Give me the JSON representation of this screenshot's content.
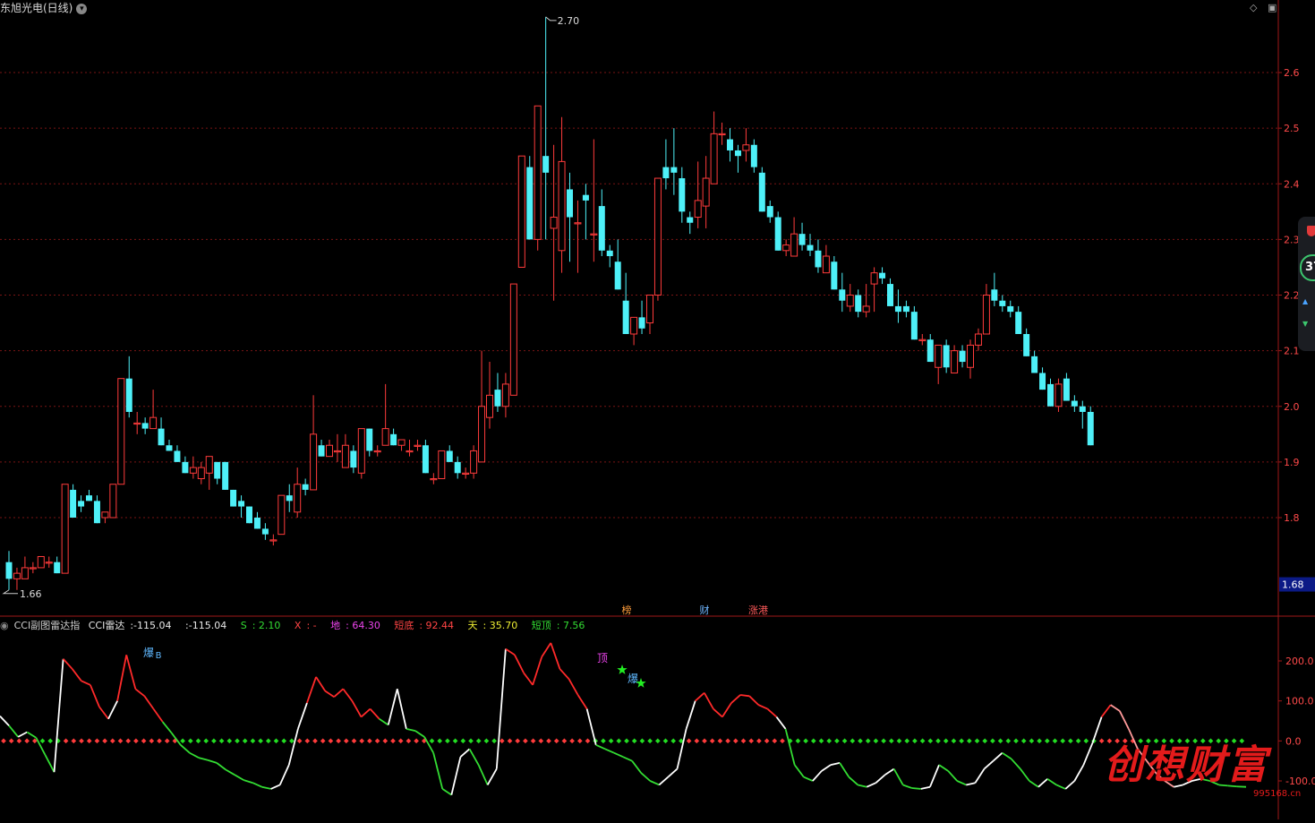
{
  "title": "东旭光电(日线)",
  "price_axis": {
    "ticks": [
      "2.6",
      "2.5",
      "2.4",
      "2.3",
      "2.2",
      "2.1",
      "2.0",
      "1.9",
      "1.8"
    ],
    "tick_values": [
      2.6,
      2.5,
      2.4,
      2.3,
      2.2,
      2.1,
      2.0,
      1.9,
      1.8
    ],
    "current_price_label": "1.68",
    "current_price": 1.68
  },
  "chart_data": [
    {
      "type": "candlestick",
      "ylim": [
        1.62,
        2.75
      ],
      "up_color": "#ff3b3b",
      "down_color": "#4ef0f8",
      "annotations": {
        "high_label": "2.70",
        "low_label": "1.66"
      },
      "event_labels": [
        "榜",
        "财",
        "涨港"
      ],
      "candles": [
        [
          1.72,
          1.74,
          1.67,
          1.69
        ],
        [
          1.69,
          1.71,
          1.67,
          1.7
        ],
        [
          1.69,
          1.73,
          1.69,
          1.71
        ],
        [
          1.71,
          1.72,
          1.7,
          1.71
        ],
        [
          1.71,
          1.73,
          1.71,
          1.73
        ],
        [
          1.72,
          1.73,
          1.71,
          1.72
        ],
        [
          1.72,
          1.73,
          1.7,
          1.7
        ],
        [
          1.7,
          1.86,
          1.7,
          1.86
        ],
        [
          1.85,
          1.86,
          1.8,
          1.8
        ],
        [
          1.83,
          1.84,
          1.81,
          1.82
        ],
        [
          1.84,
          1.85,
          1.83,
          1.83
        ],
        [
          1.83,
          1.84,
          1.79,
          1.79
        ],
        [
          1.8,
          1.81,
          1.79,
          1.81
        ],
        [
          1.8,
          1.86,
          1.8,
          1.86
        ],
        [
          1.86,
          2.05,
          1.86,
          2.05
        ],
        [
          2.05,
          2.09,
          1.98,
          1.99
        ],
        [
          1.97,
          1.99,
          1.95,
          1.97
        ],
        [
          1.97,
          1.98,
          1.95,
          1.96
        ],
        [
          1.96,
          2.03,
          1.96,
          1.98
        ],
        [
          1.96,
          1.98,
          1.93,
          1.93
        ],
        [
          1.93,
          1.94,
          1.92,
          1.92
        ],
        [
          1.92,
          1.93,
          1.9,
          1.9
        ],
        [
          1.9,
          1.91,
          1.88,
          1.88
        ],
        [
          1.88,
          1.91,
          1.87,
          1.89
        ],
        [
          1.87,
          1.9,
          1.86,
          1.89
        ],
        [
          1.88,
          1.91,
          1.85,
          1.91
        ],
        [
          1.9,
          1.9,
          1.86,
          1.87
        ],
        [
          1.9,
          1.9,
          1.85,
          1.85
        ],
        [
          1.85,
          1.85,
          1.82,
          1.82
        ],
        [
          1.83,
          1.84,
          1.8,
          1.82
        ],
        [
          1.82,
          1.82,
          1.79,
          1.79
        ],
        [
          1.8,
          1.81,
          1.78,
          1.78
        ],
        [
          1.78,
          1.79,
          1.76,
          1.77
        ],
        [
          1.76,
          1.77,
          1.75,
          1.76
        ],
        [
          1.77,
          1.84,
          1.77,
          1.84
        ],
        [
          1.84,
          1.86,
          1.81,
          1.83
        ],
        [
          1.81,
          1.89,
          1.8,
          1.86
        ],
        [
          1.86,
          1.87,
          1.84,
          1.85
        ],
        [
          1.85,
          2.02,
          1.85,
          1.95
        ],
        [
          1.93,
          1.94,
          1.91,
          1.91
        ],
        [
          1.91,
          1.94,
          1.91,
          1.93
        ],
        [
          1.92,
          1.95,
          1.9,
          1.92
        ],
        [
          1.89,
          1.95,
          1.89,
          1.93
        ],
        [
          1.92,
          1.93,
          1.88,
          1.89
        ],
        [
          1.88,
          1.95,
          1.87,
          1.96
        ],
        [
          1.96,
          1.96,
          1.91,
          1.92
        ],
        [
          1.92,
          1.93,
          1.91,
          1.92
        ],
        [
          1.93,
          2.04,
          1.93,
          1.96
        ],
        [
          1.95,
          1.96,
          1.93,
          1.93
        ],
        [
          1.93,
          1.94,
          1.92,
          1.94
        ],
        [
          1.92,
          1.94,
          1.91,
          1.92
        ],
        [
          1.93,
          1.94,
          1.92,
          1.93
        ],
        [
          1.93,
          1.94,
          1.88,
          1.88
        ],
        [
          1.87,
          1.88,
          1.86,
          1.87
        ],
        [
          1.87,
          1.92,
          1.87,
          1.92
        ],
        [
          1.92,
          1.93,
          1.9,
          1.9
        ],
        [
          1.9,
          1.91,
          1.87,
          1.88
        ],
        [
          1.88,
          1.89,
          1.87,
          1.88
        ],
        [
          1.88,
          1.93,
          1.87,
          1.92
        ],
        [
          1.9,
          2.1,
          1.9,
          2.0
        ],
        [
          1.98,
          2.08,
          1.96,
          2.02
        ],
        [
          2.03,
          2.06,
          1.99,
          2.0
        ],
        [
          2.0,
          2.06,
          1.98,
          2.04
        ],
        [
          2.02,
          2.22,
          2.02,
          2.22
        ],
        [
          2.25,
          2.42,
          2.25,
          2.45
        ],
        [
          2.43,
          2.45,
          2.3,
          2.3
        ],
        [
          2.3,
          2.54,
          2.28,
          2.54
        ],
        [
          2.45,
          2.7,
          2.3,
          2.42
        ],
        [
          2.32,
          2.47,
          2.19,
          2.34
        ],
        [
          2.28,
          2.52,
          2.24,
          2.44
        ],
        [
          2.39,
          2.42,
          2.26,
          2.34
        ],
        [
          2.33,
          2.37,
          2.24,
          2.33
        ],
        [
          2.38,
          2.4,
          2.3,
          2.37
        ],
        [
          2.31,
          2.48,
          2.26,
          2.31
        ],
        [
          2.36,
          2.39,
          2.27,
          2.28
        ],
        [
          2.28,
          2.29,
          2.25,
          2.27
        ],
        [
          2.26,
          2.3,
          2.21,
          2.21
        ],
        [
          2.19,
          2.24,
          2.13,
          2.13
        ],
        [
          2.13,
          2.16,
          2.11,
          2.16
        ],
        [
          2.16,
          2.19,
          2.13,
          2.14
        ],
        [
          2.15,
          2.2,
          2.13,
          2.2
        ],
        [
          2.2,
          2.41,
          2.19,
          2.41
        ],
        [
          2.43,
          2.48,
          2.39,
          2.41
        ],
        [
          2.43,
          2.5,
          2.38,
          2.42
        ],
        [
          2.41,
          2.43,
          2.33,
          2.35
        ],
        [
          2.34,
          2.35,
          2.31,
          2.33
        ],
        [
          2.34,
          2.44,
          2.32,
          2.37
        ],
        [
          2.36,
          2.45,
          2.32,
          2.41
        ],
        [
          2.4,
          2.53,
          2.4,
          2.49
        ],
        [
          2.49,
          2.51,
          2.47,
          2.49
        ],
        [
          2.48,
          2.5,
          2.44,
          2.46
        ],
        [
          2.46,
          2.47,
          2.42,
          2.45
        ],
        [
          2.46,
          2.5,
          2.44,
          2.47
        ],
        [
          2.47,
          2.48,
          2.42,
          2.43
        ],
        [
          2.42,
          2.43,
          2.35,
          2.35
        ],
        [
          2.36,
          2.37,
          2.33,
          2.34
        ],
        [
          2.34,
          2.35,
          2.28,
          2.28
        ],
        [
          2.28,
          2.3,
          2.27,
          2.29
        ],
        [
          2.27,
          2.34,
          2.27,
          2.31
        ],
        [
          2.31,
          2.33,
          2.28,
          2.29
        ],
        [
          2.29,
          2.31,
          2.27,
          2.28
        ],
        [
          2.28,
          2.3,
          2.24,
          2.25
        ],
        [
          2.24,
          2.29,
          2.24,
          2.27
        ],
        [
          2.26,
          2.27,
          2.21,
          2.21
        ],
        [
          2.21,
          2.24,
          2.17,
          2.19
        ],
        [
          2.18,
          2.22,
          2.17,
          2.2
        ],
        [
          2.2,
          2.21,
          2.16,
          2.17
        ],
        [
          2.17,
          2.22,
          2.16,
          2.18
        ],
        [
          2.22,
          2.25,
          2.17,
          2.24
        ],
        [
          2.24,
          2.25,
          2.22,
          2.23
        ],
        [
          2.22,
          2.23,
          2.18,
          2.18
        ],
        [
          2.18,
          2.21,
          2.15,
          2.17
        ],
        [
          2.18,
          2.19,
          2.16,
          2.17
        ],
        [
          2.17,
          2.18,
          2.12,
          2.12
        ],
        [
          2.12,
          2.13,
          2.11,
          2.12
        ],
        [
          2.12,
          2.13,
          2.08,
          2.08
        ],
        [
          2.07,
          2.11,
          2.04,
          2.11
        ],
        [
          2.11,
          2.12,
          2.06,
          2.07
        ],
        [
          2.06,
          2.11,
          2.06,
          2.1
        ],
        [
          2.1,
          2.11,
          2.07,
          2.08
        ],
        [
          2.07,
          2.12,
          2.05,
          2.11
        ],
        [
          2.11,
          2.14,
          2.1,
          2.13
        ],
        [
          2.13,
          2.22,
          2.13,
          2.2
        ],
        [
          2.21,
          2.24,
          2.18,
          2.19
        ],
        [
          2.19,
          2.2,
          2.17,
          2.18
        ],
        [
          2.18,
          2.19,
          2.16,
          2.17
        ],
        [
          2.17,
          2.18,
          2.13,
          2.13
        ],
        [
          2.13,
          2.14,
          2.09,
          2.09
        ],
        [
          2.09,
          2.1,
          2.06,
          2.06
        ],
        [
          2.06,
          2.07,
          2.03,
          2.03
        ],
        [
          2.04,
          2.05,
          2.0,
          2.0
        ],
        [
          2.0,
          2.05,
          1.99,
          2.04
        ],
        [
          2.05,
          2.06,
          2.01,
          2.01
        ],
        [
          2.01,
          2.02,
          1.99,
          2.0
        ],
        [
          2.0,
          2.01,
          1.96,
          1.99
        ],
        [
          1.99,
          2.0,
          1.93,
          1.93
        ]
      ]
    },
    {
      "type": "line",
      "title": "CCI副图雷达指",
      "ylim": [
        -140,
        270
      ],
      "y_ticks": [
        "200.0",
        "100.0",
        "0.0",
        "-100.0"
      ],
      "y_tick_values": [
        200,
        100,
        0,
        -100
      ],
      "legend": {
        "main": {
          "name": "CCI雷达",
          "value": "-115.04"
        },
        "second": {
          "value": "-115.04"
        },
        "s": {
          "name": "S",
          "value": "2.10"
        },
        "x": {
          "name": "X",
          "value": "-"
        },
        "di": {
          "name": "地",
          "value": "64.30"
        },
        "duandi": {
          "name": "短底",
          "value": "92.44"
        },
        "tian": {
          "name": "天",
          "value": "35.70"
        },
        "duanding": {
          "name": "短顶",
          "value": "7.56"
        }
      },
      "marker_labels": {
        "bao": "爆",
        "b": "B",
        "ding": "顶"
      },
      "zero_line_colors": {
        "above": "#ff3b3b",
        "below": "#22dd22"
      },
      "line_colors": {
        "white": "#ffffff",
        "red": "#ff2a2a",
        "green": "#33dd33",
        "pink": "#ff9a9a"
      },
      "values": [
        62,
        38,
        10,
        22,
        8,
        -35,
        -78,
        205,
        180,
        150,
        140,
        85,
        55,
        100,
        215,
        130,
        112,
        80,
        48,
        20,
        -10,
        -30,
        -42,
        -48,
        -55,
        -72,
        -85,
        -98,
        -105,
        -115,
        -120,
        -110,
        -60,
        30,
        95,
        160,
        125,
        110,
        130,
        100,
        60,
        80,
        55,
        40,
        130,
        30,
        25,
        10,
        -30,
        -120,
        -135,
        -40,
        -20,
        -60,
        -110,
        -70,
        230,
        215,
        170,
        140,
        210,
        245,
        180,
        155,
        115,
        80,
        -10,
        -20,
        -30,
        -40,
        -50,
        -80,
        -100,
        -110,
        -90,
        -70,
        30,
        100,
        120,
        80,
        60,
        95,
        115,
        112,
        90,
        80,
        60,
        30,
        -60,
        -90,
        -100,
        -75,
        -60,
        -55,
        -90,
        -110,
        -115,
        -105,
        -85,
        -70,
        -110,
        -118,
        -120,
        -115,
        -60,
        -75,
        -100,
        -110,
        -105,
        -70,
        -50,
        -30,
        -45,
        -70,
        -100,
        -115,
        -95,
        -110,
        -120,
        -100,
        -60,
        -5,
        60,
        90,
        75,
        30,
        -20,
        -50,
        -80,
        -100,
        -115,
        -110,
        -100,
        -95,
        -100,
        -110,
        -112,
        -114,
        -115
      ]
    }
  ]
}
